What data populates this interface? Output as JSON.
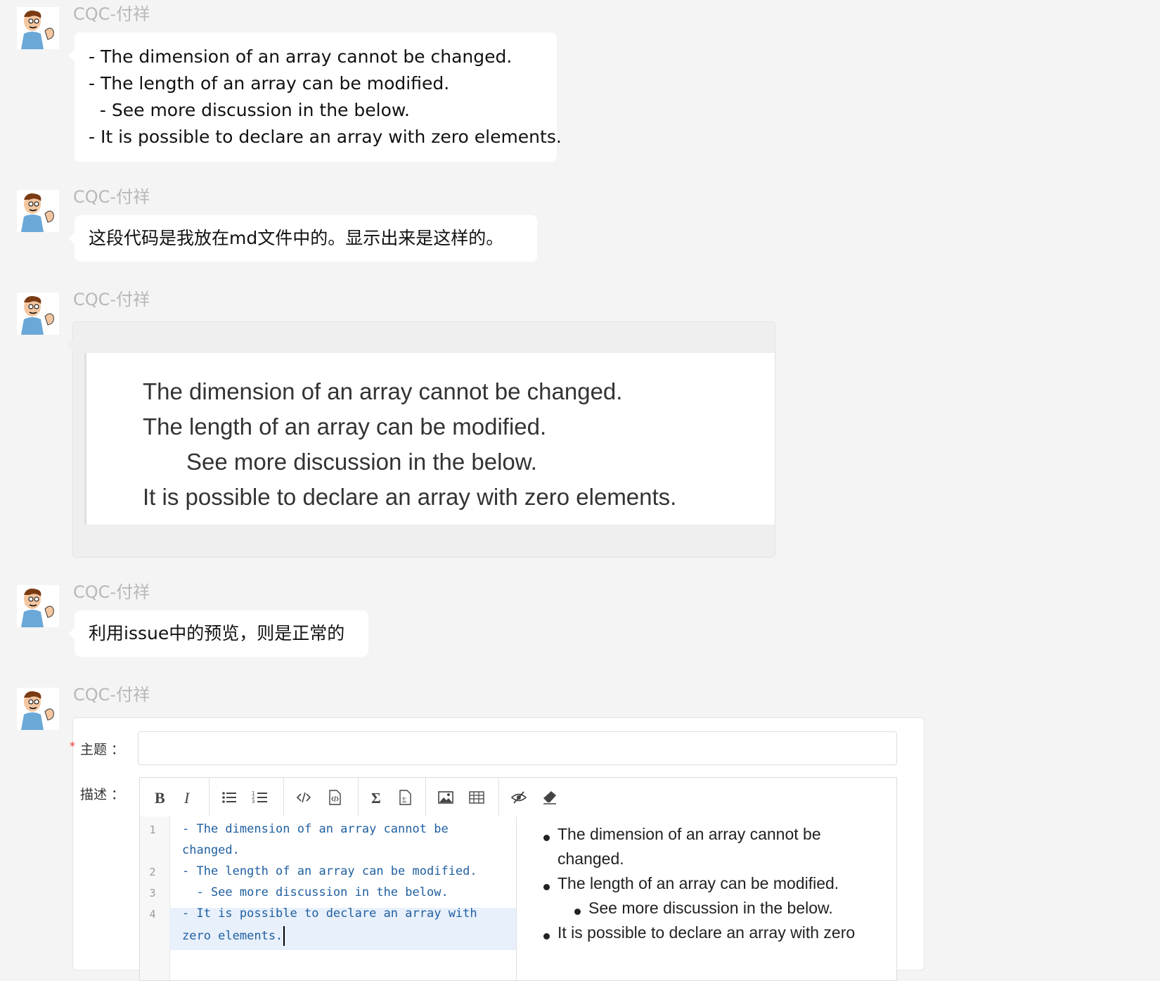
{
  "messages": [
    {
      "author": "CQC-付祥",
      "lines": [
        "- The dimension of an array cannot be changed.",
        "- The length of an array can be modified.",
        "  - See more discussion in the below.",
        "- It is possible to declare an array with zero elements."
      ]
    },
    {
      "author": "CQC-付祥",
      "text": "这段代码是我放在md文件中的。显示出来是这样的。"
    },
    {
      "author": "CQC-付祥",
      "rendered_lines": [
        "The dimension of an array cannot be changed.",
        "The length of an array can be modified.",
        "See more discussion in the below.",
        "It is possible to declare an array with zero elements."
      ]
    },
    {
      "author": "CQC-付祥",
      "text": "利用issue中的预览，则是正常的"
    },
    {
      "author": "CQC-付祥",
      "form": {
        "subject_label": "主题 ：",
        "subject_value": "",
        "required_mark": "*",
        "description_label": "描述 ：",
        "toolbar": [
          "bold-icon",
          "italic-icon",
          "bullet-list-icon",
          "numbered-list-icon",
          "code-icon",
          "code-block-icon",
          "sigma-icon",
          "formula-icon",
          "image-icon",
          "table-icon",
          "preview-toggle-icon",
          "eraser-icon"
        ],
        "line_numbers": [
          "1",
          "2",
          "3",
          "4"
        ],
        "code_lines": [
          "- The dimension of an array cannot be",
          "changed.",
          "- The length of an array can be modified.",
          "  - See more discussion in the below.",
          "- It is possible to declare an array with",
          "zero elements."
        ],
        "preview_lines": [
          "The dimension of an array cannot be",
          "changed.",
          "The length of an array can be modified.",
          "See more discussion in the below.",
          "It is possible to declare an array with zero"
        ]
      }
    }
  ],
  "colors": {
    "background": "#f4f4f4",
    "bubble": "#ffffff",
    "author": "#b8b8b8",
    "code_text": "#1f5fa0",
    "highlight_line": "#e8f0fb"
  }
}
